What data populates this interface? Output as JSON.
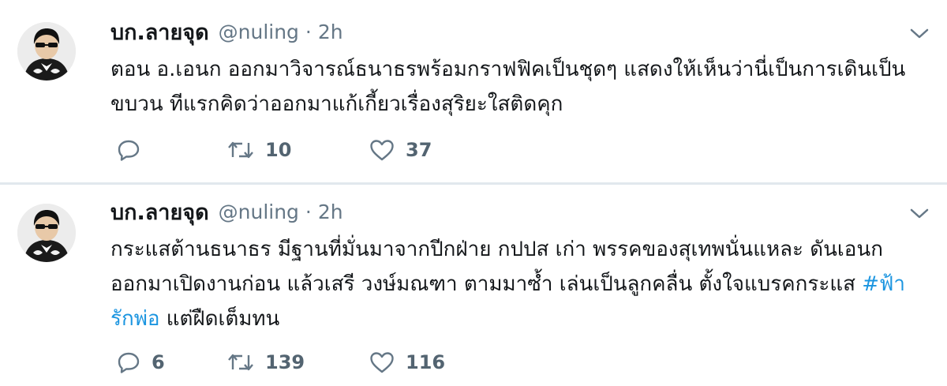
{
  "tweets": [
    {
      "display_name": "บก.ลายจุด",
      "handle": "@nuling",
      "separator": "·",
      "time": "2h",
      "text_line1": "ตอน อ.เอนก ออกมาวิจารณ์ธนาธรพร้อมกราฟฟิคเป็นชุดๆ แสดงให้เห็นว่านี่เป็นการเดินเป็น",
      "text_line2": "ขบวน ทีแรกคิดว่าออกมาแก้เกี้ยวเรื่องสุริยะใสติดคุก",
      "replies": "",
      "retweets": "10",
      "likes": "37"
    },
    {
      "display_name": "บก.ลายจุด",
      "handle": "@nuling",
      "separator": "·",
      "time": "2h",
      "text_line1": "กระแสต้านธนาธร มีฐานที่มั่นมาจากปีกฝ่าย กปปส เก่า พรรคของสุเทพนั่นแหละ ดันเอนก",
      "text_line2": "ออกมาเปิดงานก่อน แล้วเสรี วงษ์มณฑา ตามมาซ้ำ เล่นเป็นลูกคลื่น ตั้งใจแบรคกระแส ",
      "hashtag_part1": "#ฟ้า",
      "hashtag_part2": "รักพ่อ",
      "text_line3_rest": " แต่ฝืดเต็มทน",
      "replies": "6",
      "retweets": "139",
      "likes": "116"
    }
  ],
  "colors": {
    "link": "#1b95e0",
    "secondary_text": "#657786",
    "divider": "#e1e8ed"
  },
  "icons": [
    "avatar-image",
    "chevron-down-icon",
    "reply-icon",
    "retweet-icon",
    "like-icon"
  ]
}
